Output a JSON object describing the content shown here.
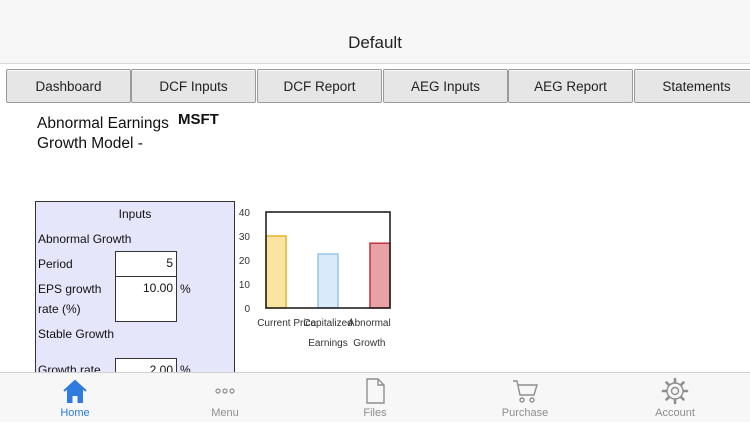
{
  "header": {
    "title": "Default"
  },
  "tabs": [
    {
      "label": "Dashboard"
    },
    {
      "label": "DCF Inputs"
    },
    {
      "label": "DCF Report"
    },
    {
      "label": "AEG Inputs"
    },
    {
      "label": "AEG Report"
    },
    {
      "label": "Statements"
    }
  ],
  "model": {
    "title": "Abnormal Earnings Growth Model -",
    "ticker": "MSFT"
  },
  "inputs_panel": {
    "heading": "Inputs",
    "abnormal_growth_label": "Abnormal Growth",
    "period_label": "Period",
    "period_value": "5",
    "eps_growth_label": "EPS growth rate (%)",
    "eps_growth_value": "10.00",
    "eps_growth_unit": "%",
    "stable_growth_label": "Stable Growth",
    "growth_rate_label": "Growth rate",
    "growth_rate_value": "2.00",
    "growth_rate_unit": "%"
  },
  "chart_data": {
    "type": "bar",
    "categories": [
      "Current Price",
      "Capitalized Earnings",
      "Abnormal Growth"
    ],
    "category_lines": [
      [
        "Current Price"
      ],
      [
        "Capitalized",
        "Earnings"
      ],
      [
        "Abnormal",
        "Growth"
      ]
    ],
    "values": [
      30,
      22.5,
      27
    ],
    "ylim": [
      0,
      40
    ],
    "yticks": [
      "0",
      "10",
      "20",
      "30",
      "40"
    ],
    "colors": [
      {
        "fill": "#fbe3a2",
        "stroke": "#e3b42a"
      },
      {
        "fill": "#d9ebfa",
        "stroke": "#96c5ea"
      },
      {
        "fill": "#e8a1a5",
        "stroke": "#c4303d"
      }
    ],
    "grid": false
  },
  "bottom_nav": {
    "items": [
      {
        "label": "Home",
        "icon": "home-icon",
        "active": true
      },
      {
        "label": "Menu",
        "icon": "more-icon",
        "active": false
      },
      {
        "label": "Files",
        "icon": "file-icon",
        "active": false
      },
      {
        "label": "Purchase",
        "icon": "cart-icon",
        "active": false
      },
      {
        "label": "Account",
        "icon": "gear-icon",
        "active": false
      }
    ],
    "active_color": "#2f7be0",
    "inactive_color": "#8e8e8e"
  }
}
